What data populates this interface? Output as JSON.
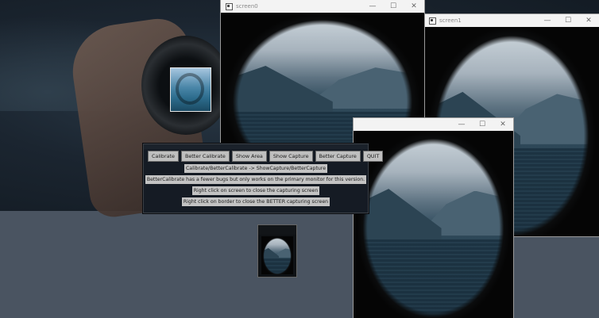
{
  "windows": {
    "screen0": {
      "title": "screen0"
    },
    "screen1": {
      "title": "screen1"
    }
  },
  "titlebar_controls": {
    "minimize": "—",
    "maximize": "☐",
    "close": "✕"
  },
  "panel": {
    "buttons": [
      "Calibrate",
      "Better Calibrate",
      "Show Area",
      "Show Capture",
      "Better Capture",
      "QUIT"
    ],
    "info_lines": [
      "Calibrate/BetterCalibrate -> ShowCapture/BetterCapture",
      "BetterCalibrate has a fewer bugs but only works on the primary monitor for this version.",
      "Right click on screen to close the capturing screen",
      "Right click on border to close the BETTER capturing screen"
    ]
  },
  "colors": {
    "panel_bg": "#151b24",
    "button_bg": "#bfbfbf",
    "desktop_grey": "#4a5461"
  }
}
